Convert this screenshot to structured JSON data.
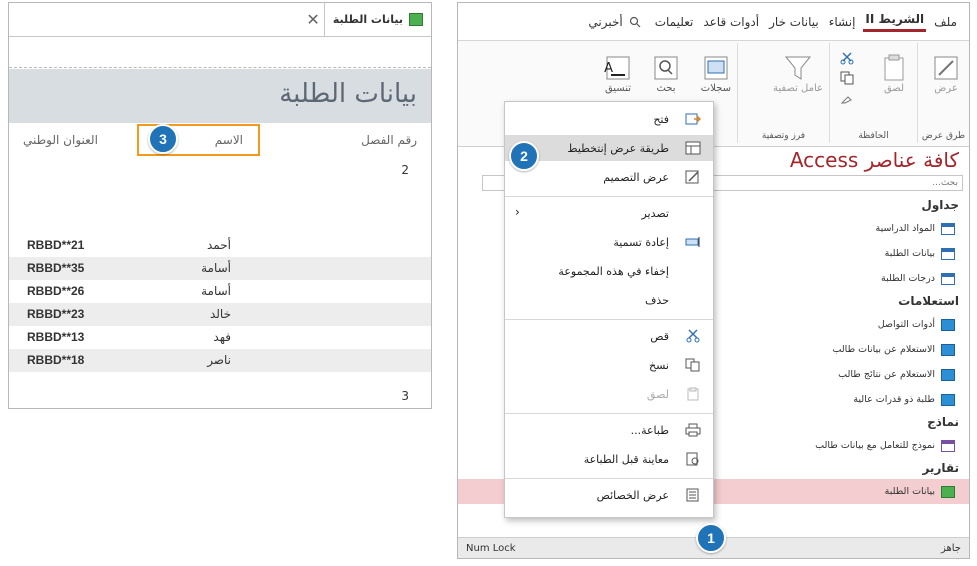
{
  "colors": {
    "accent": "#a4262c",
    "badge": "#1f73b6",
    "highlight_box": "#f39a1e",
    "selected_nav": "#f3cdd0"
  },
  "report": {
    "tab_title": "بيانات الطلبة",
    "header_title": "بيانات الطلبة",
    "columns": {
      "class_no": "رقم الفصل",
      "name": "الاسم",
      "address": "العنوان الوطني"
    },
    "groups": [
      "2",
      "3"
    ],
    "rows": [
      {
        "name": "أحمد",
        "address": "RBBD**21"
      },
      {
        "name": "أسامة",
        "address": "RBBD**35"
      },
      {
        "name": "أسامة",
        "address": "RBBD**26"
      },
      {
        "name": "خالد",
        "address": "RBBD**23"
      },
      {
        "name": "فهد",
        "address": "RBBD**13"
      },
      {
        "name": "ناصر",
        "address": "RBBD**18"
      }
    ]
  },
  "access": {
    "tabs": [
      "ملف",
      "الشريط II",
      "إنشاء",
      "بيانات خار",
      "أدوات قاعد",
      "تعليمات"
    ],
    "search_label": "أخبرني",
    "ribbon": {
      "groups": [
        "طرق عرض",
        "الحافظة",
        "فرز وتصفية"
      ],
      "buttons": {
        "view": "عرض",
        "paste": "لصق",
        "filter": "عامل تصفية",
        "records": "سجلات",
        "find": "بحث",
        "format": "تنسيق"
      }
    },
    "nav_title": "كافة عناصر Access",
    "nav_search_placeholder": "بحث...",
    "nav": [
      {
        "type": "cat",
        "label": "جداول"
      },
      {
        "type": "item",
        "icon": "table-icon",
        "label": "المواد الدراسية"
      },
      {
        "type": "item",
        "icon": "table-icon",
        "label": "بيانات الطلبة"
      },
      {
        "type": "item",
        "icon": "table-icon",
        "label": "درجات الطلبة"
      },
      {
        "type": "cat",
        "label": "استعلامات"
      },
      {
        "type": "item",
        "icon": "query-icon",
        "label": "أدوات التواصل"
      },
      {
        "type": "item",
        "icon": "query-icon",
        "label": "الاستعلام عن بيانات طالب"
      },
      {
        "type": "item",
        "icon": "query-icon",
        "label": "الاستعلام عن نتائج طالب"
      },
      {
        "type": "item",
        "icon": "query-icon",
        "label": "طلبة ذو قدرات عالية"
      },
      {
        "type": "cat",
        "label": "نماذج"
      },
      {
        "type": "item",
        "icon": "form-icon",
        "label": "نموذج للتعامل مع بيانات طالب"
      },
      {
        "type": "cat",
        "label": "تقارير"
      },
      {
        "type": "item",
        "icon": "report-icon",
        "label": "بيانات الطلبة",
        "selected": true
      }
    ],
    "status_left": "Num Lock",
    "status_right": "جاهز"
  },
  "context_menu": [
    {
      "label": "فتح",
      "icon": "open-icon"
    },
    {
      "label": "طريقة عرض إنتخطيط",
      "icon": "layout-view-icon",
      "highlighted": true
    },
    {
      "label": "عرض التصميم",
      "icon": "design-view-icon"
    },
    {
      "sep": true
    },
    {
      "label": "تصدير",
      "submenu": true
    },
    {
      "label": "إعادة تسمية",
      "icon": "rename-icon"
    },
    {
      "label": "إخفاء في هذه المجموعة"
    },
    {
      "label": "حذف"
    },
    {
      "sep": true
    },
    {
      "label": "قص",
      "icon": "cut-icon"
    },
    {
      "label": "نسخ",
      "icon": "copy-icon"
    },
    {
      "label": "لصق",
      "icon": "paste-icon",
      "disabled": true
    },
    {
      "sep": true
    },
    {
      "label": "طباعة...",
      "icon": "print-icon"
    },
    {
      "label": "معاينة قبل الطباعة",
      "icon": "print-preview-icon"
    },
    {
      "sep": true
    },
    {
      "label": "عرض الخصائص",
      "icon": "properties-icon"
    }
  ],
  "badges": [
    "1",
    "2",
    "3"
  ]
}
